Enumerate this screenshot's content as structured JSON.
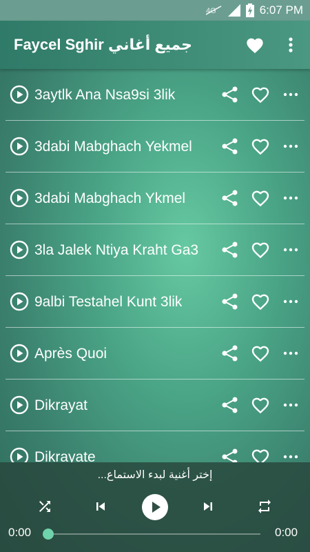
{
  "status_bar": {
    "time": "6:07 PM",
    "icons": [
      "data-off-icon",
      "signal-icon",
      "battery-charging-icon"
    ]
  },
  "app_bar": {
    "title": "Faycel Sghir جميع أغاني",
    "icons": [
      "heart-icon",
      "more-vert-icon"
    ]
  },
  "songs": [
    {
      "title": "3aytlk Ana Nsa9si 3lik"
    },
    {
      "title": "3dabi Mabghach Yekmel"
    },
    {
      "title": "3dabi Mabghach Ykmel"
    },
    {
      "title": "3la Jalek Ntiya Kraht Ga3"
    },
    {
      "title": "9albi Testahel Kunt 3lik"
    },
    {
      "title": "Après Quoi"
    },
    {
      "title": "Dikrayat"
    },
    {
      "title": "Dikrayate"
    }
  ],
  "row_icons": [
    "play-circle-icon",
    "share-icon",
    "heart-outline-icon",
    "more-horiz-icon"
  ],
  "player": {
    "now_playing": "إختر أغنية لبدء الاستماع...",
    "time_current": "0:00",
    "time_total": "0:00",
    "progress": 0,
    "controls": [
      "shuffle-icon",
      "skip-previous-icon",
      "play-icon",
      "skip-next-icon",
      "repeat-icon"
    ]
  },
  "colors": {
    "accent": "#6fd3ab",
    "app_bar": "#3d8b75",
    "status_bar": "#6b9e91"
  }
}
